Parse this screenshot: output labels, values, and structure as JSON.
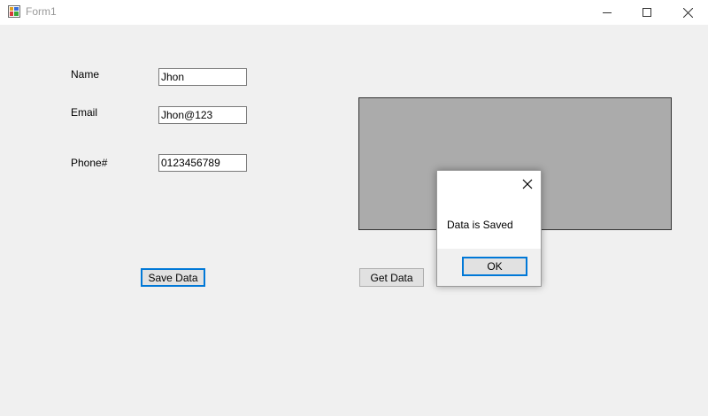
{
  "window": {
    "title": "Form1"
  },
  "form": {
    "name_label": "Name",
    "name_value": "Jhon",
    "email_label": "Email",
    "email_value": "Jhon@123",
    "phone_label": "Phone#",
    "phone_value": "0123456789",
    "save_button": "Save Data",
    "get_button": "Get Data"
  },
  "dialog": {
    "message": "Data is Saved",
    "ok_button": "OK"
  },
  "colors": {
    "accent": "#0078d7",
    "grid_background": "#ababab",
    "form_background": "#f0f0f0"
  }
}
